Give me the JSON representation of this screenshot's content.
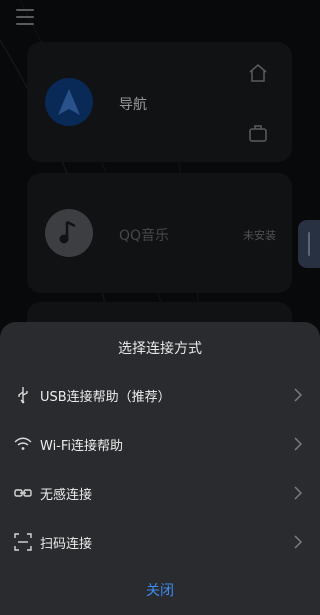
{
  "cards": [
    {
      "title": "导航",
      "icon": "navigation-arrow-icon",
      "actions": [
        "home-icon",
        "briefcase-icon"
      ]
    },
    {
      "title": "QQ音乐",
      "icon": "music-note-icon",
      "status": "未安装"
    }
  ],
  "sheet": {
    "title": "选择连接方式",
    "options": [
      {
        "label": "USB连接帮助（推荐）",
        "icon": "usb-icon"
      },
      {
        "label": "Wi-Fi连接帮助",
        "icon": "wifi-icon"
      },
      {
        "label": "无感连接",
        "icon": "link-icon"
      },
      {
        "label": "扫码连接",
        "icon": "scan-icon"
      }
    ],
    "close_label": "关闭"
  },
  "colors": {
    "accent": "#3d8bf0",
    "sheet_bg": "#2a2b2e",
    "card_bg": "#1b1c1f",
    "nav_badge": "#0f3f86"
  }
}
